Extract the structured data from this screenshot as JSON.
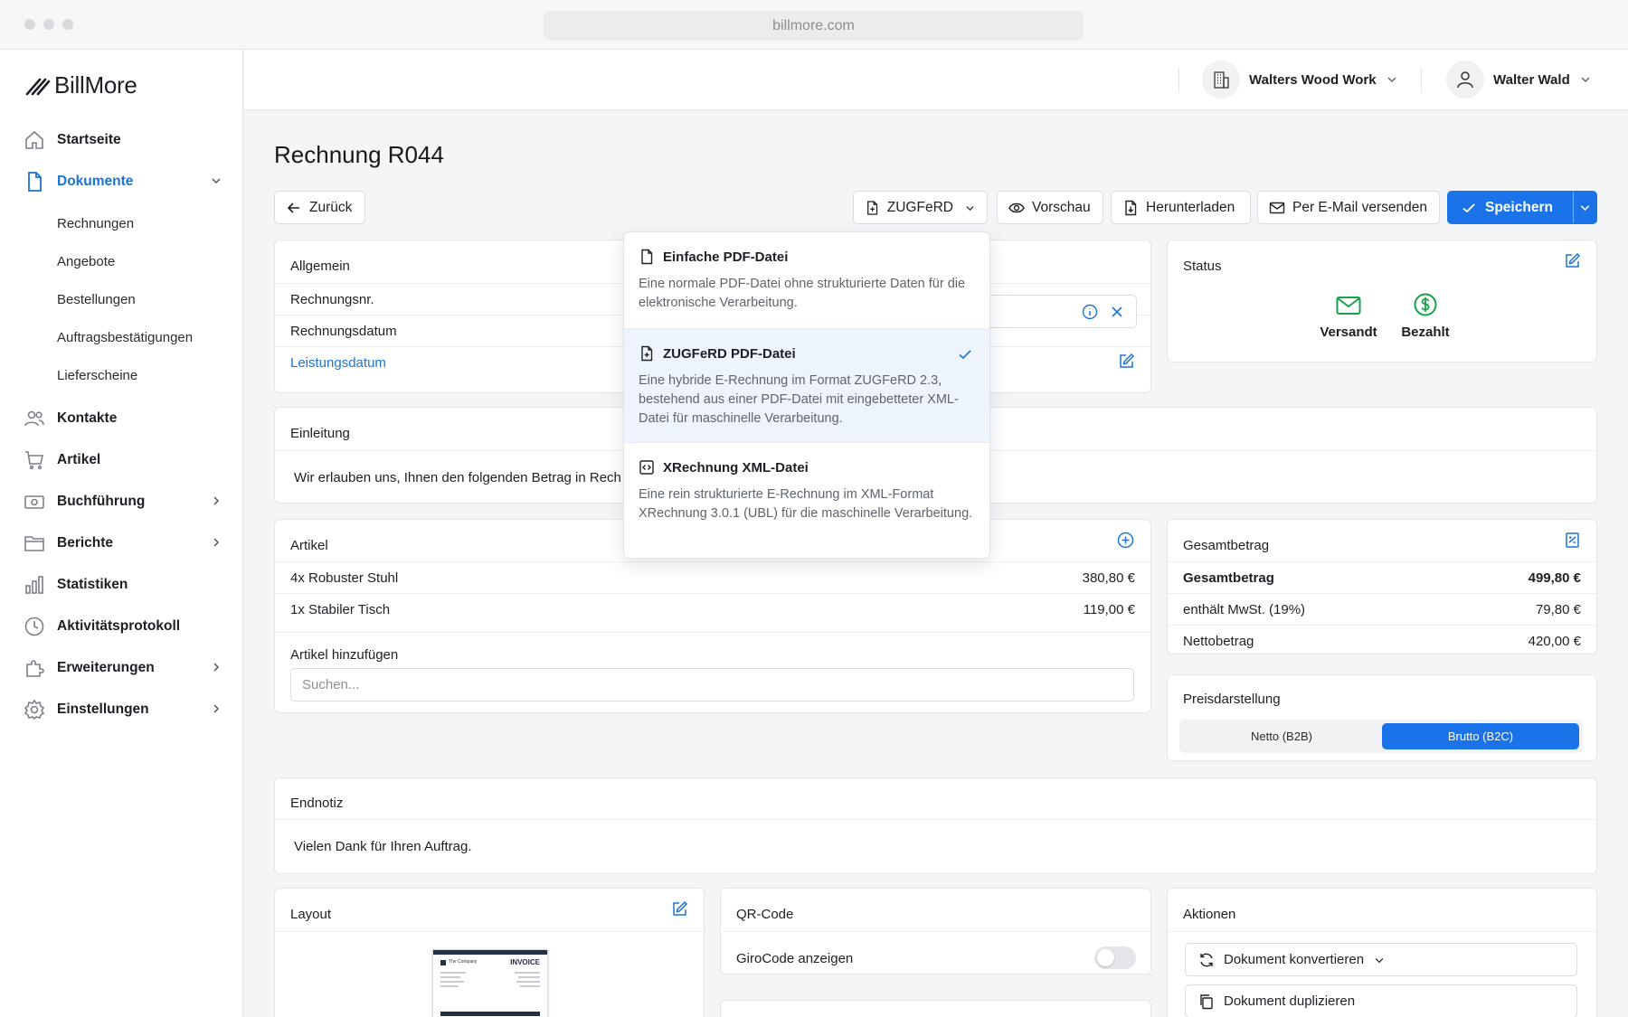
{
  "browser": {
    "url": "billmore.com"
  },
  "sidebar": {
    "logo": "BillMore",
    "items": [
      {
        "label": "Startseite",
        "icon": "home-icon"
      },
      {
        "label": "Dokumente",
        "icon": "document-icon",
        "active": true
      },
      {
        "label": "Kontakte",
        "icon": "users-icon"
      },
      {
        "label": "Artikel",
        "icon": "cart-icon"
      },
      {
        "label": "Buchführung",
        "icon": "money-icon"
      },
      {
        "label": "Berichte",
        "icon": "folder-icon"
      },
      {
        "label": "Statistiken",
        "icon": "bar-chart-icon"
      },
      {
        "label": "Aktivitätsprotokoll",
        "icon": "clock-icon"
      },
      {
        "label": "Erweiterungen",
        "icon": "puzzle-icon"
      },
      {
        "label": "Einstellungen",
        "icon": "gear-icon"
      }
    ],
    "sub_items": [
      "Rechnungen",
      "Angebote",
      "Bestellungen",
      "Auftragsbestätigungen",
      "Lieferscheine"
    ]
  },
  "header": {
    "company": "Walters Wood Work",
    "user": "Walter Wald"
  },
  "page": {
    "title": "Rechnung R044"
  },
  "toolbar": {
    "back": "Zurück",
    "format": "ZUGFeRD",
    "preview": "Vorschau",
    "download": "Herunterladen",
    "email": "Per E-Mail versenden",
    "save": "Speichern"
  },
  "format_menu": {
    "options": [
      {
        "title": "Einfache PDF-Datei",
        "description": "Eine normale PDF-Datei ohne strukturierte Daten für die elektronische Verarbeitung."
      },
      {
        "title": "ZUGFeRD PDF-Datei",
        "description": "Eine hybride E-Rechnung im Format ZUGFeRD 2.3, bestehend aus einer PDF-Datei mit eingebetteter XML-Datei für maschinelle Verarbeitung.",
        "selected": true
      },
      {
        "title": "XRechnung XML-Datei",
        "description": "Eine rein strukturierte E-Rechnung im XML-Format XRechnung 3.0.1 (UBL) für die maschinelle Verarbeitung."
      }
    ]
  },
  "general": {
    "title": "Allgemein",
    "rows": [
      "Rechnungsnr.",
      "Rechnungsdatum",
      "Leistungsdatum"
    ]
  },
  "status": {
    "title": "Status",
    "sent": "Versandt",
    "paid": "Bezahlt"
  },
  "intro": {
    "title": "Einleitung",
    "text": "Wir erlauben uns, Ihnen den folgenden Betrag in Rech"
  },
  "articles": {
    "title": "Artikel",
    "items": [
      {
        "name": "4x Robuster Stuhl",
        "price": "380,80 €"
      },
      {
        "name": "1x Stabiler Tisch",
        "price": "119,00 €"
      }
    ],
    "add_label": "Artikel hinzufügen",
    "search_placeholder": "Suchen..."
  },
  "totals": {
    "title": "Gesamtbetrag",
    "rows": [
      {
        "label": "Gesamtbetrag",
        "value": "499,80 €"
      },
      {
        "label": "enthält MwSt. (19%)",
        "value": "79,80 €"
      },
      {
        "label": "Nettobetrag",
        "value": "420,00 €"
      }
    ]
  },
  "pricing": {
    "title": "Preisdarstellung",
    "net": "Netto (B2B)",
    "gross": "Brutto (B2C)"
  },
  "endnote": {
    "title": "Endnotiz",
    "text": "Vielen Dank für Ihren Auftrag."
  },
  "layout": {
    "title": "Layout",
    "thumb_company": "The Company",
    "thumb_heading": "INVOICE"
  },
  "qrcode": {
    "title": "QR-Code",
    "label": "GiroCode anzeigen",
    "enabled": false
  },
  "actions": {
    "title": "Aktionen",
    "convert": "Dokument konvertieren",
    "duplicate": "Dokument duplizieren"
  },
  "colors": {
    "accent": "#1a73e8",
    "success": "#16a34a",
    "text": "#1d1f24"
  }
}
